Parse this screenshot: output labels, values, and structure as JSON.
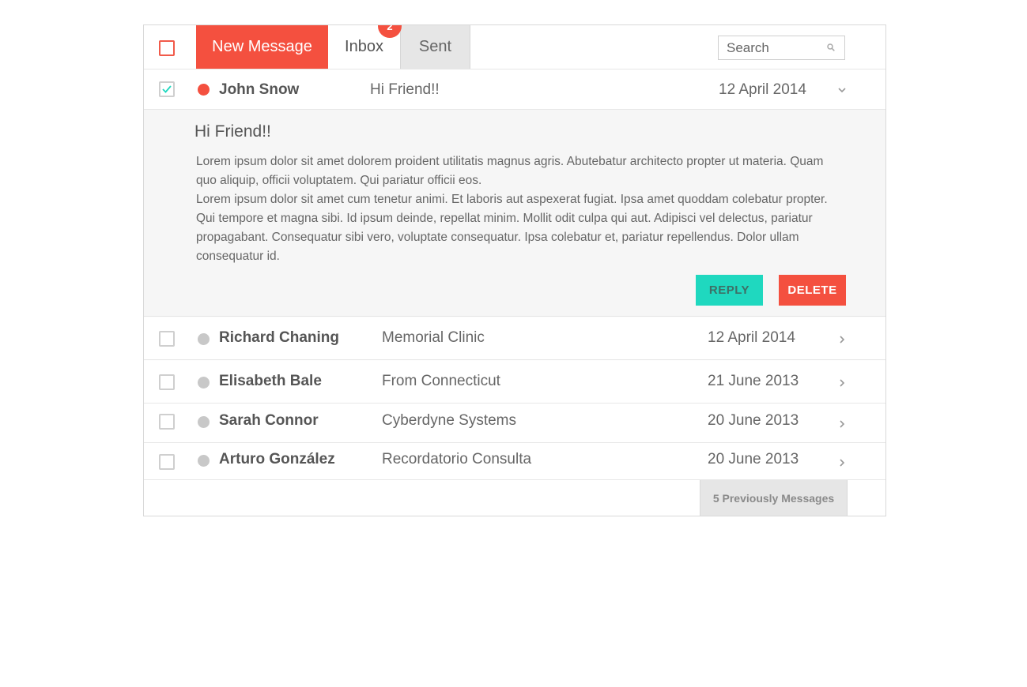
{
  "toolbar": {
    "new_message_label": "New Message",
    "inbox_label": "Inbox",
    "inbox_badge": "2",
    "sent_label": "Sent",
    "search_placeholder": "Search"
  },
  "open_message": {
    "sender": "John Snow",
    "subject": "Hi Friend!!",
    "date": "12 April 2014",
    "title": "Hi Friend!!",
    "body_paragraph_1": "Lorem ipsum dolor sit amet dolorem proident utilitatis magnus agris. Abutebatur architecto propter ut materia. Quam quo aliquip, officii voluptatem. Qui pariatur officii eos.",
    "body_paragraph_2": "Lorem ipsum dolor sit amet cum tenetur animi. Et laboris aut aspexerat fugiat. Ipsa amet quoddam colebatur propter. Qui tempore et magna sibi. Id ipsum deinde, repellat minim. Mollit odit culpa qui aut. Adipisci vel delectus, pariatur propagabant. Consequatur sibi vero, voluptate consequatur. Ipsa colebatur et, pariatur repellendus. Dolor ullam consequatur id.",
    "reply_label": "REPLY",
    "delete_label": "DELETE"
  },
  "messages": [
    {
      "sender": "Richard Chaning",
      "subject": "Memorial Clinic",
      "date": "12 April 2014"
    },
    {
      "sender": "Elisabeth Bale",
      "subject": "From Connecticut",
      "date": "21 June 2013"
    },
    {
      "sender": "Sarah Connor",
      "subject": "Cyberdyne Systems",
      "date": "20 June 2013"
    },
    {
      "sender": "Arturo González",
      "subject": "Recordatorio Consulta",
      "date": "20 June 2013"
    }
  ],
  "footer": {
    "previous_label": "5 Previously Messages"
  },
  "colors": {
    "accent": "#f4503f",
    "teal": "#1fd8bf",
    "tab_inactive": "#e6e6e6"
  }
}
